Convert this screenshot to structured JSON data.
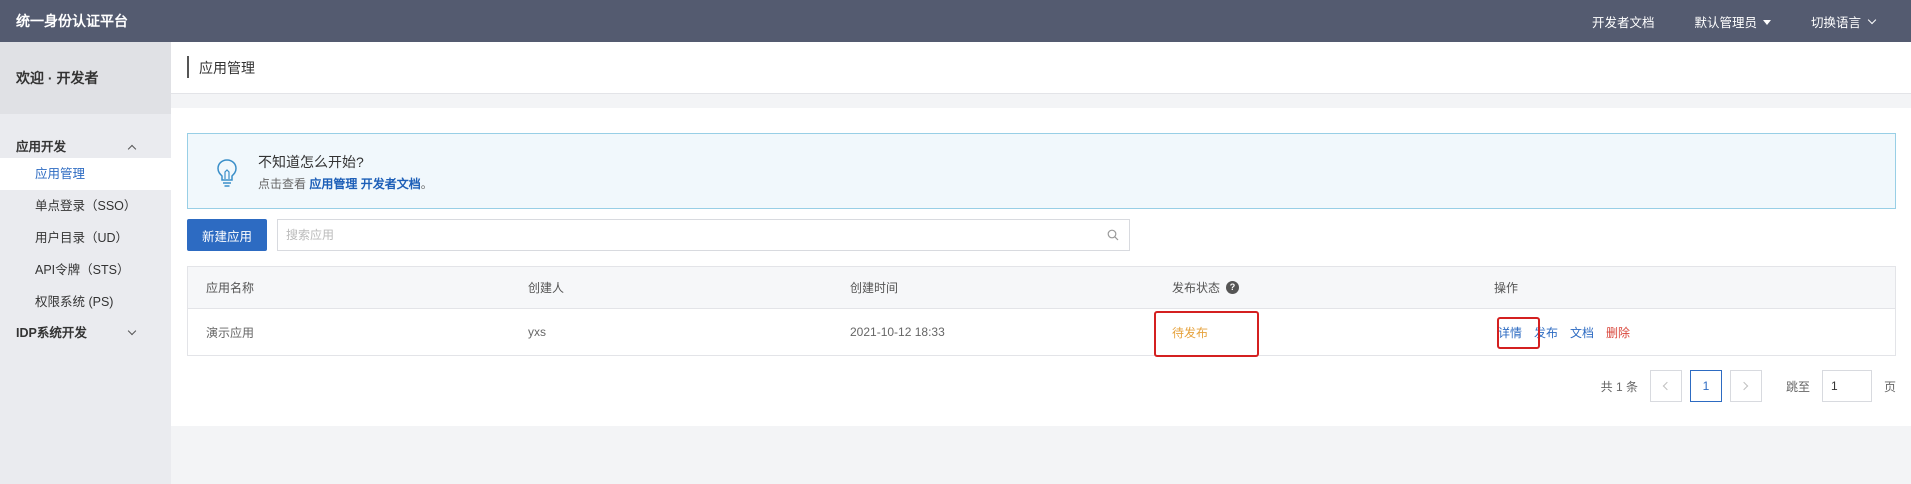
{
  "header": {
    "brand": "统一身份认证平台",
    "nav": {
      "docs": "开发者文档",
      "admin": "默认管理员",
      "language": "切换语言"
    }
  },
  "sidebar": {
    "welcome": "欢迎 · 开发者",
    "groups": [
      {
        "label": "应用开发",
        "expanded": true,
        "items": [
          {
            "label": "应用管理",
            "active": true
          },
          {
            "label": "单点登录（SSO）"
          },
          {
            "label": "用户目录（UD）"
          },
          {
            "label": "API令牌（STS）"
          },
          {
            "label": "权限系统 (PS)"
          }
        ]
      },
      {
        "label": "IDP系统开发",
        "expanded": false
      }
    ]
  },
  "page": {
    "title": "应用管理"
  },
  "tip": {
    "title": "不知道怎么开始?",
    "prefix": "点击查看",
    "link": "应用管理 开发者文档",
    "suffix": "。"
  },
  "toolbar": {
    "new_button": "新建应用",
    "search_placeholder": "搜索应用"
  },
  "table": {
    "columns": [
      "应用名称",
      "创建人",
      "创建时间",
      "发布状态",
      "操作"
    ],
    "help_icon": "?",
    "rows": [
      {
        "name": "演示应用",
        "creator": "yxs",
        "created_at": "2021-10-12 18:33",
        "status": "待发布",
        "actions": [
          "详情",
          "发布",
          "文档",
          "删除"
        ]
      }
    ]
  },
  "pagination": {
    "total": "共 1 条",
    "current_page": "1",
    "goto_label": "跳至",
    "goto_value": "1",
    "page_suffix": "页"
  },
  "colors": {
    "topbar": "#545b70",
    "primary": "#2d6bc2",
    "pending": "#e6a23c",
    "danger": "#d9473c",
    "highlight": "#d42020"
  },
  "icons": [
    "lightbulb-icon",
    "search-icon",
    "help-icon",
    "chevron-down-icon",
    "chevron-up-icon",
    "caret-down-icon",
    "arrow-left-icon",
    "arrow-right-icon"
  ]
}
